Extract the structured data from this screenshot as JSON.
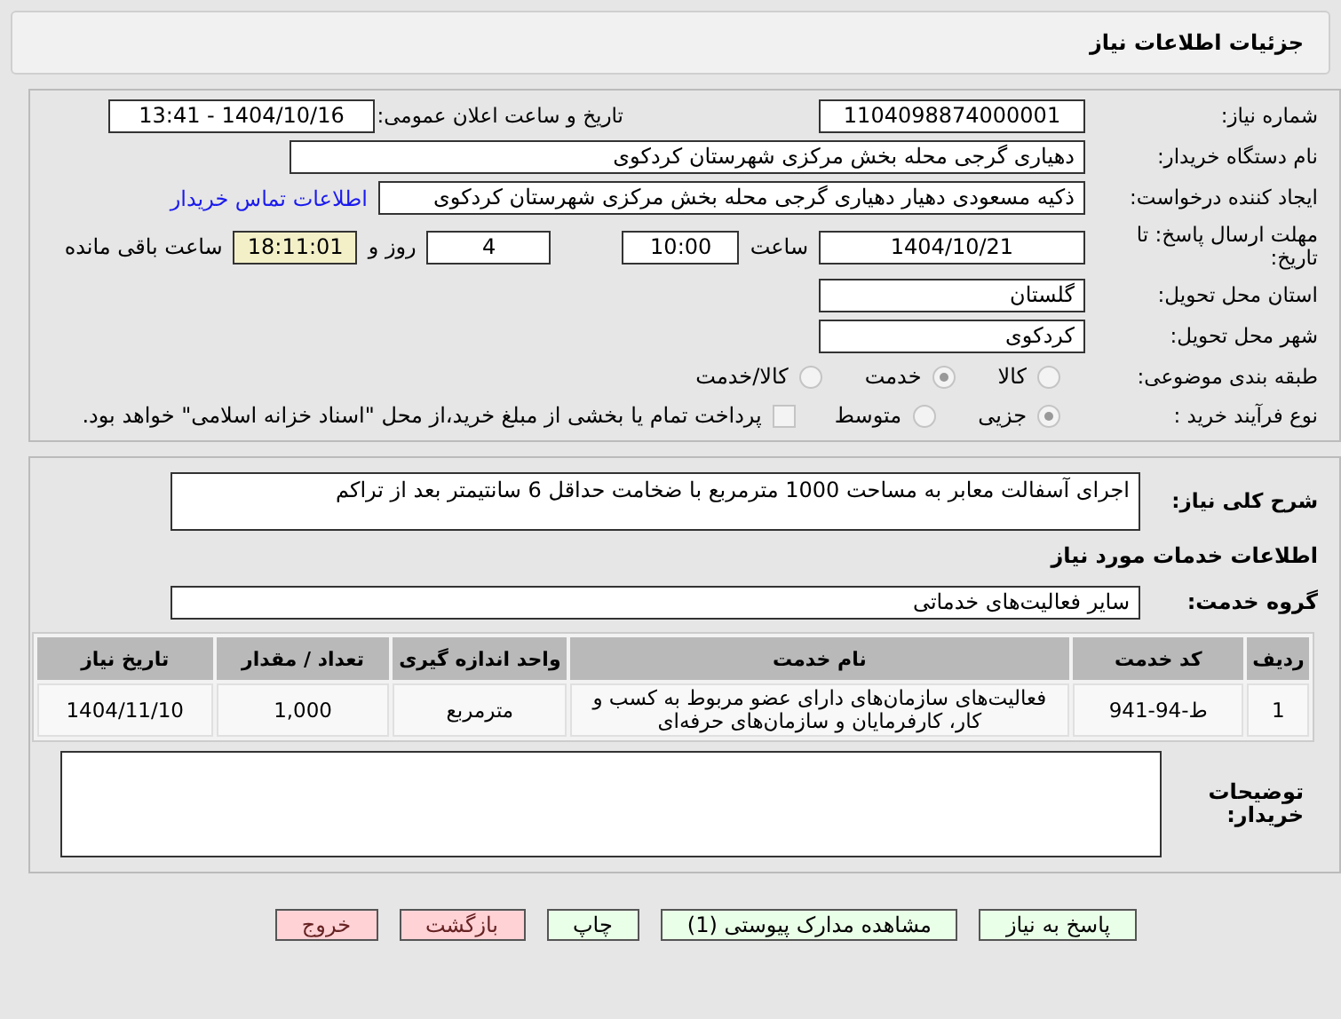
{
  "header": {
    "title": "جزئیات اطلاعات نیاز"
  },
  "info": {
    "need_number": {
      "label": "شماره نیاز:",
      "value": "1104098874000001"
    },
    "announce": {
      "label": "تاریخ و ساعت اعلان عمومی:",
      "value": "1404/10/16 - 13:41"
    },
    "buyer": {
      "label": "نام دستگاه خریدار:",
      "value": "دهیاری گرجی محله بخش مرکزی شهرستان کردکوی"
    },
    "creator": {
      "label": "ایجاد کننده درخواست:",
      "value": "ذکیه مسعودی دهیار دهیاری گرجی محله بخش مرکزی شهرستان کردکوی",
      "link": "اطلاعات تماس خریدار"
    },
    "deadline": {
      "label": "مهلت ارسال پاسخ: تا تاریخ:",
      "date": "1404/10/21",
      "time_label": "ساعت",
      "time": "10:00",
      "days": "4",
      "days_label": "روز و",
      "remaining": "18:11:01",
      "remaining_label": "ساعت باقی مانده"
    },
    "province": {
      "label": "استان محل تحویل:",
      "value": "گلستان"
    },
    "city": {
      "label": "شهر محل تحویل:",
      "value": "کردکوی"
    },
    "category": {
      "label": "طبقه بندی موضوعی:",
      "options": [
        {
          "label": "کالا",
          "selected": false
        },
        {
          "label": "خدمت",
          "selected": true
        },
        {
          "label": "کالا/خدمت",
          "selected": false
        }
      ]
    },
    "process": {
      "label": "نوع فرآیند خرید :",
      "options": [
        {
          "label": "جزیی",
          "selected": true
        },
        {
          "label": "متوسط",
          "selected": false
        }
      ],
      "payment": {
        "checked": false,
        "text": "پرداخت تمام یا بخشی از مبلغ خرید،از محل \"اسناد خزانه اسلامی\" خواهد بود."
      }
    }
  },
  "details": {
    "description": {
      "label": "شرح کلی نیاز:",
      "value": "اجرای آسفالت معابر به مساحت 1000 مترمربع با ضخامت حداقل 6 سانتیمتر بعد از تراکم"
    },
    "services_title": "اطلاعات خدمات مورد نیاز",
    "service_group": {
      "label": "گروه خدمت:",
      "value": "سایر فعالیت‌های خدماتی"
    },
    "table": {
      "columns": [
        "ردیف",
        "کد خدمت",
        "نام خدمت",
        "واحد اندازه گیری",
        "تعداد / مقدار",
        "تاریخ نیاز"
      ],
      "rows": [
        [
          "1",
          "ط-94-941",
          "فعالیت‌های سازمان‌های دارای عضو مربوط به کسب و کار، کارفرمایان و سازمان‌های حرفه‌ای",
          "مترمربع",
          "1,000",
          "1404/11/10"
        ]
      ]
    },
    "notes": {
      "label": "توضیحات خریدار:"
    }
  },
  "buttons": [
    {
      "label": "پاسخ به نیاز",
      "kind": "go"
    },
    {
      "label": "مشاهده مدارک پیوستی (1)",
      "kind": "go"
    },
    {
      "label": "چاپ",
      "kind": "go"
    },
    {
      "label": "بازگشت",
      "kind": "stop"
    },
    {
      "label": "خروج",
      "kind": "stop"
    }
  ]
}
